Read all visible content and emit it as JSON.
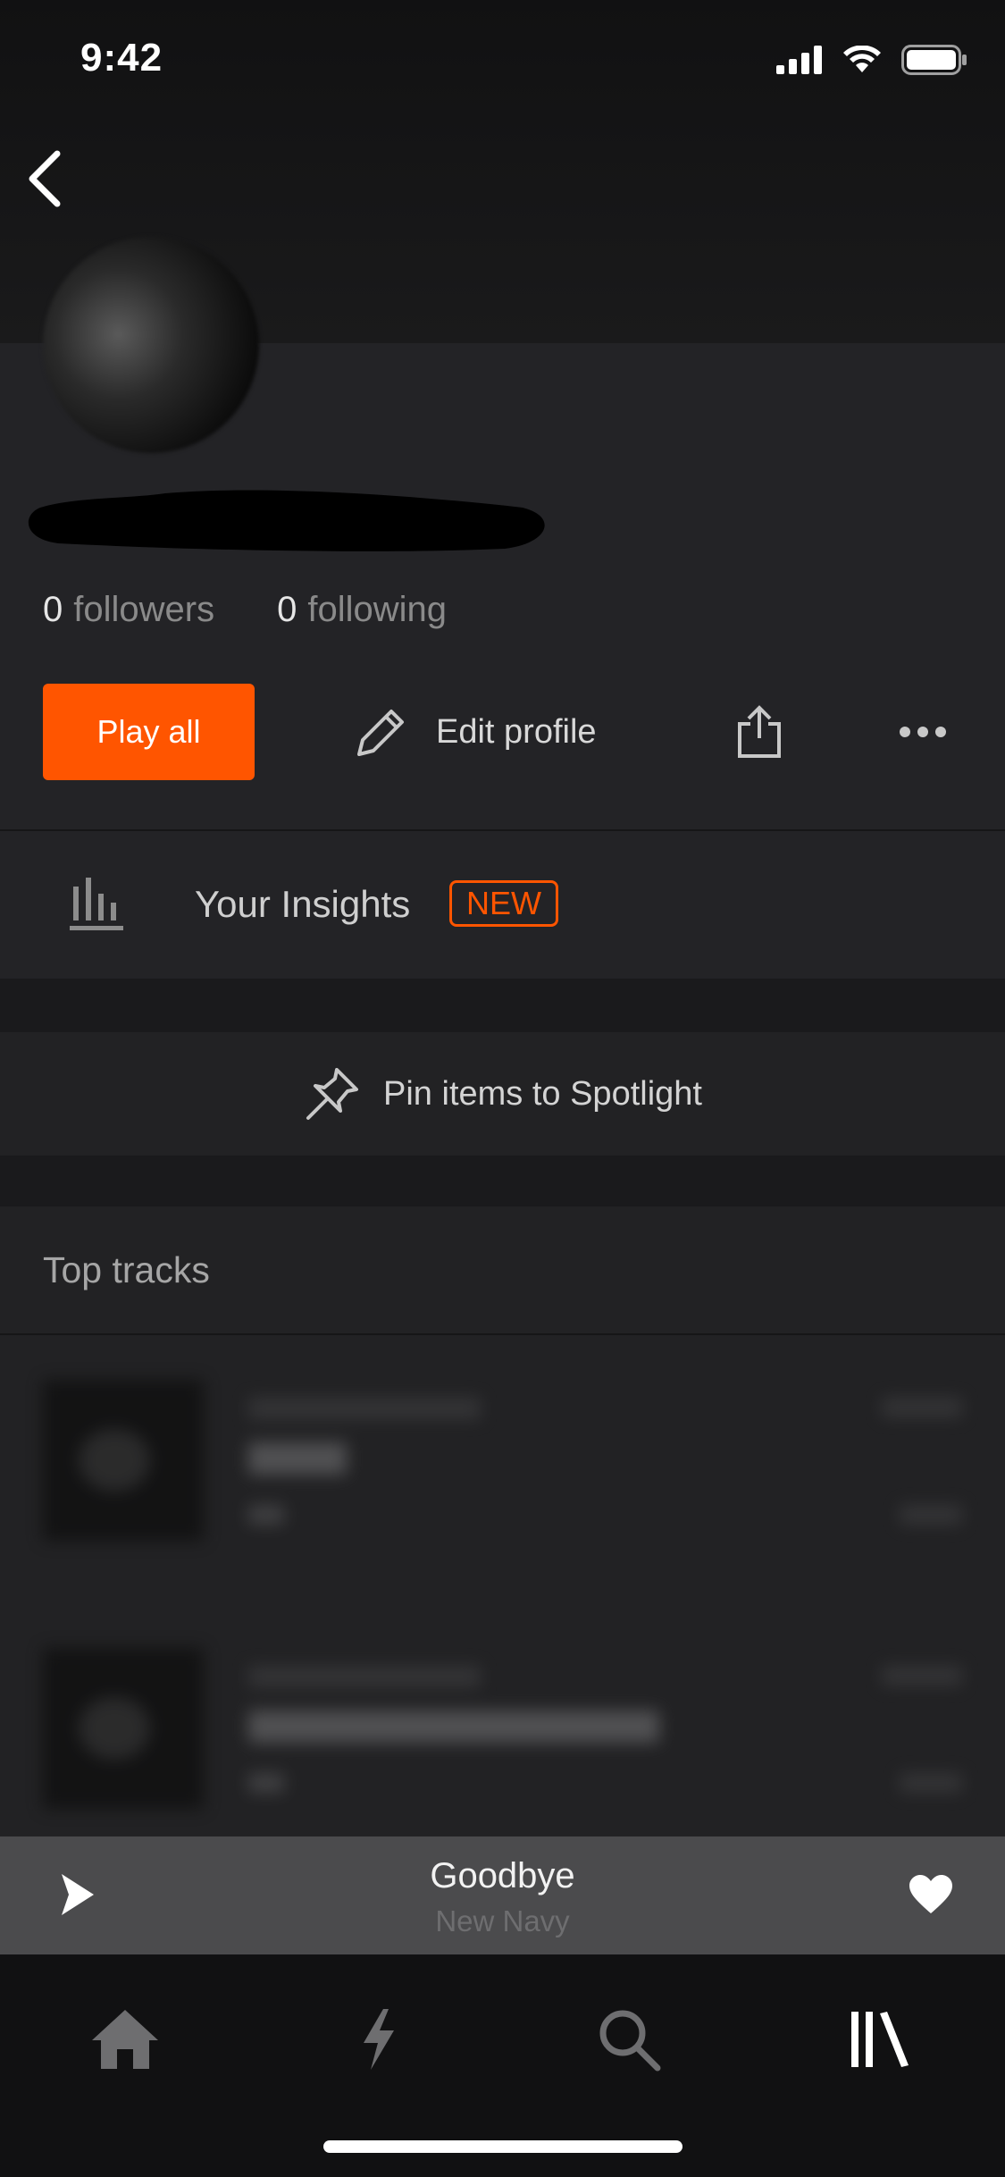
{
  "status_bar": {
    "time": "9:42"
  },
  "header": {
    "back_icon": "chevron-left-icon"
  },
  "profile": {
    "followers_count": "0",
    "followers_label": "followers",
    "following_count": "0",
    "following_label": "following"
  },
  "actions": {
    "play_all_label": "Play all",
    "edit_profile_label": "Edit profile",
    "share_icon": "share-icon",
    "more_icon": "more-icon"
  },
  "insights": {
    "label": "Your Insights",
    "badge": "NEW"
  },
  "spotlight": {
    "label": "Pin items to Spotlight"
  },
  "top_tracks": {
    "title": "Top tracks"
  },
  "mini_player": {
    "title": "Goodbye",
    "artist": "New Navy"
  },
  "tab_bar": {
    "tabs": [
      {
        "icon": "home-icon"
      },
      {
        "icon": "stream-icon"
      },
      {
        "icon": "search-icon"
      },
      {
        "icon": "library-icon"
      }
    ]
  },
  "colors": {
    "accent": "#ff5500",
    "background": "#232326",
    "mini_player_bg": "#4b4b4d",
    "tab_bar_bg": "#111112"
  }
}
